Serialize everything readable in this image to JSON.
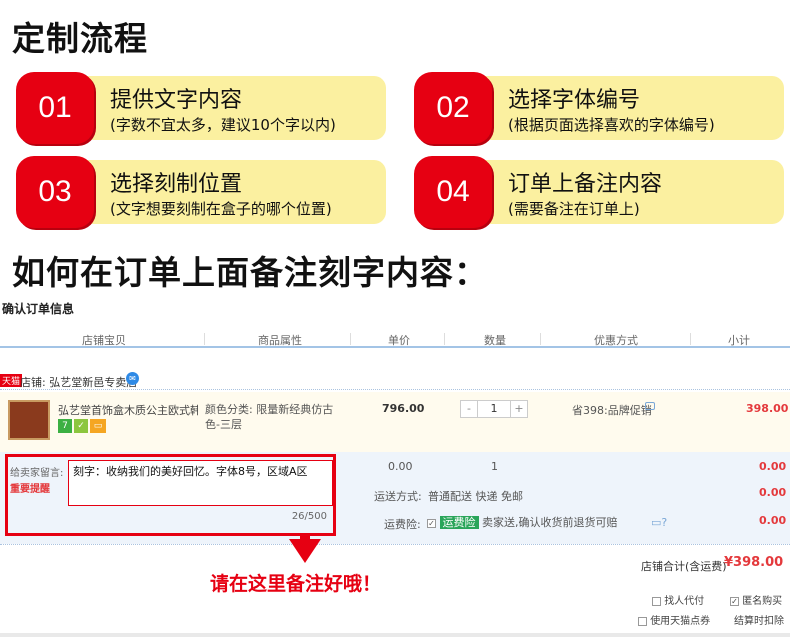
{
  "title": "定制流程",
  "steps": [
    {
      "num": "01",
      "main": "提供文字内容",
      "sub": "(字数不宜太多，建议10个字以内)"
    },
    {
      "num": "02",
      "main": "选择字体编号",
      "sub": "(根据页面选择喜欢的字体编号)"
    },
    {
      "num": "03",
      "main": "选择刻制位置",
      "sub": "(文字想要刻制在盒子的哪个位置)"
    },
    {
      "num": "04",
      "main": "订单上备注内容",
      "sub": "(需要备注在订单上)"
    }
  ],
  "heading2": "如何在订单上面备注刻字内容：",
  "order": {
    "title": "确认订单信息",
    "columns": [
      "店铺宝贝",
      "商品属性",
      "单价",
      "数量",
      "优惠方式",
      "小计"
    ],
    "shop_tag": "天猫",
    "shop_name": "店铺: 弘艺堂新邑专卖店",
    "product_name": "弘艺堂首饰盒木质公主欧式韩国...",
    "attribute": "颜色分类: 限量新经典仿古色-三层",
    "price": "796.00",
    "qty_minus": "-",
    "qty": "1",
    "qty_plus": "+",
    "promo": "省398:品牌促销",
    "subtotal": "398.00",
    "msg_label": "给卖家留言:",
    "msg_important": "重要提醒",
    "msg_text": "刻字：收纳我们的美好回忆。字体8号，区域A区",
    "msg_count": "26/500",
    "extra_price": "0.00",
    "extra_qty": "1",
    "extra_total": "0.00",
    "ship_label": "运送方式:",
    "ship_value": "普通配送 快递 免邮",
    "ship_total": "0.00",
    "ins_label": "运费险:",
    "ins_tag": "运费险",
    "ins_text": "卖家送,确认收货前退货可赔",
    "ins_total": "0.00",
    "total_label": "店铺合计(含运费)",
    "total_value": "¥398.00",
    "opt1": "找人代付",
    "opt2": "匿名购买",
    "opt3": "使用天猫点券",
    "opt4": "结算时扣除"
  },
  "note": "请在这里备注好哦！",
  "colors": {
    "red": "#e60012",
    "yellow": "#fbf0a0",
    "blue_line": "#a3c4e6"
  }
}
